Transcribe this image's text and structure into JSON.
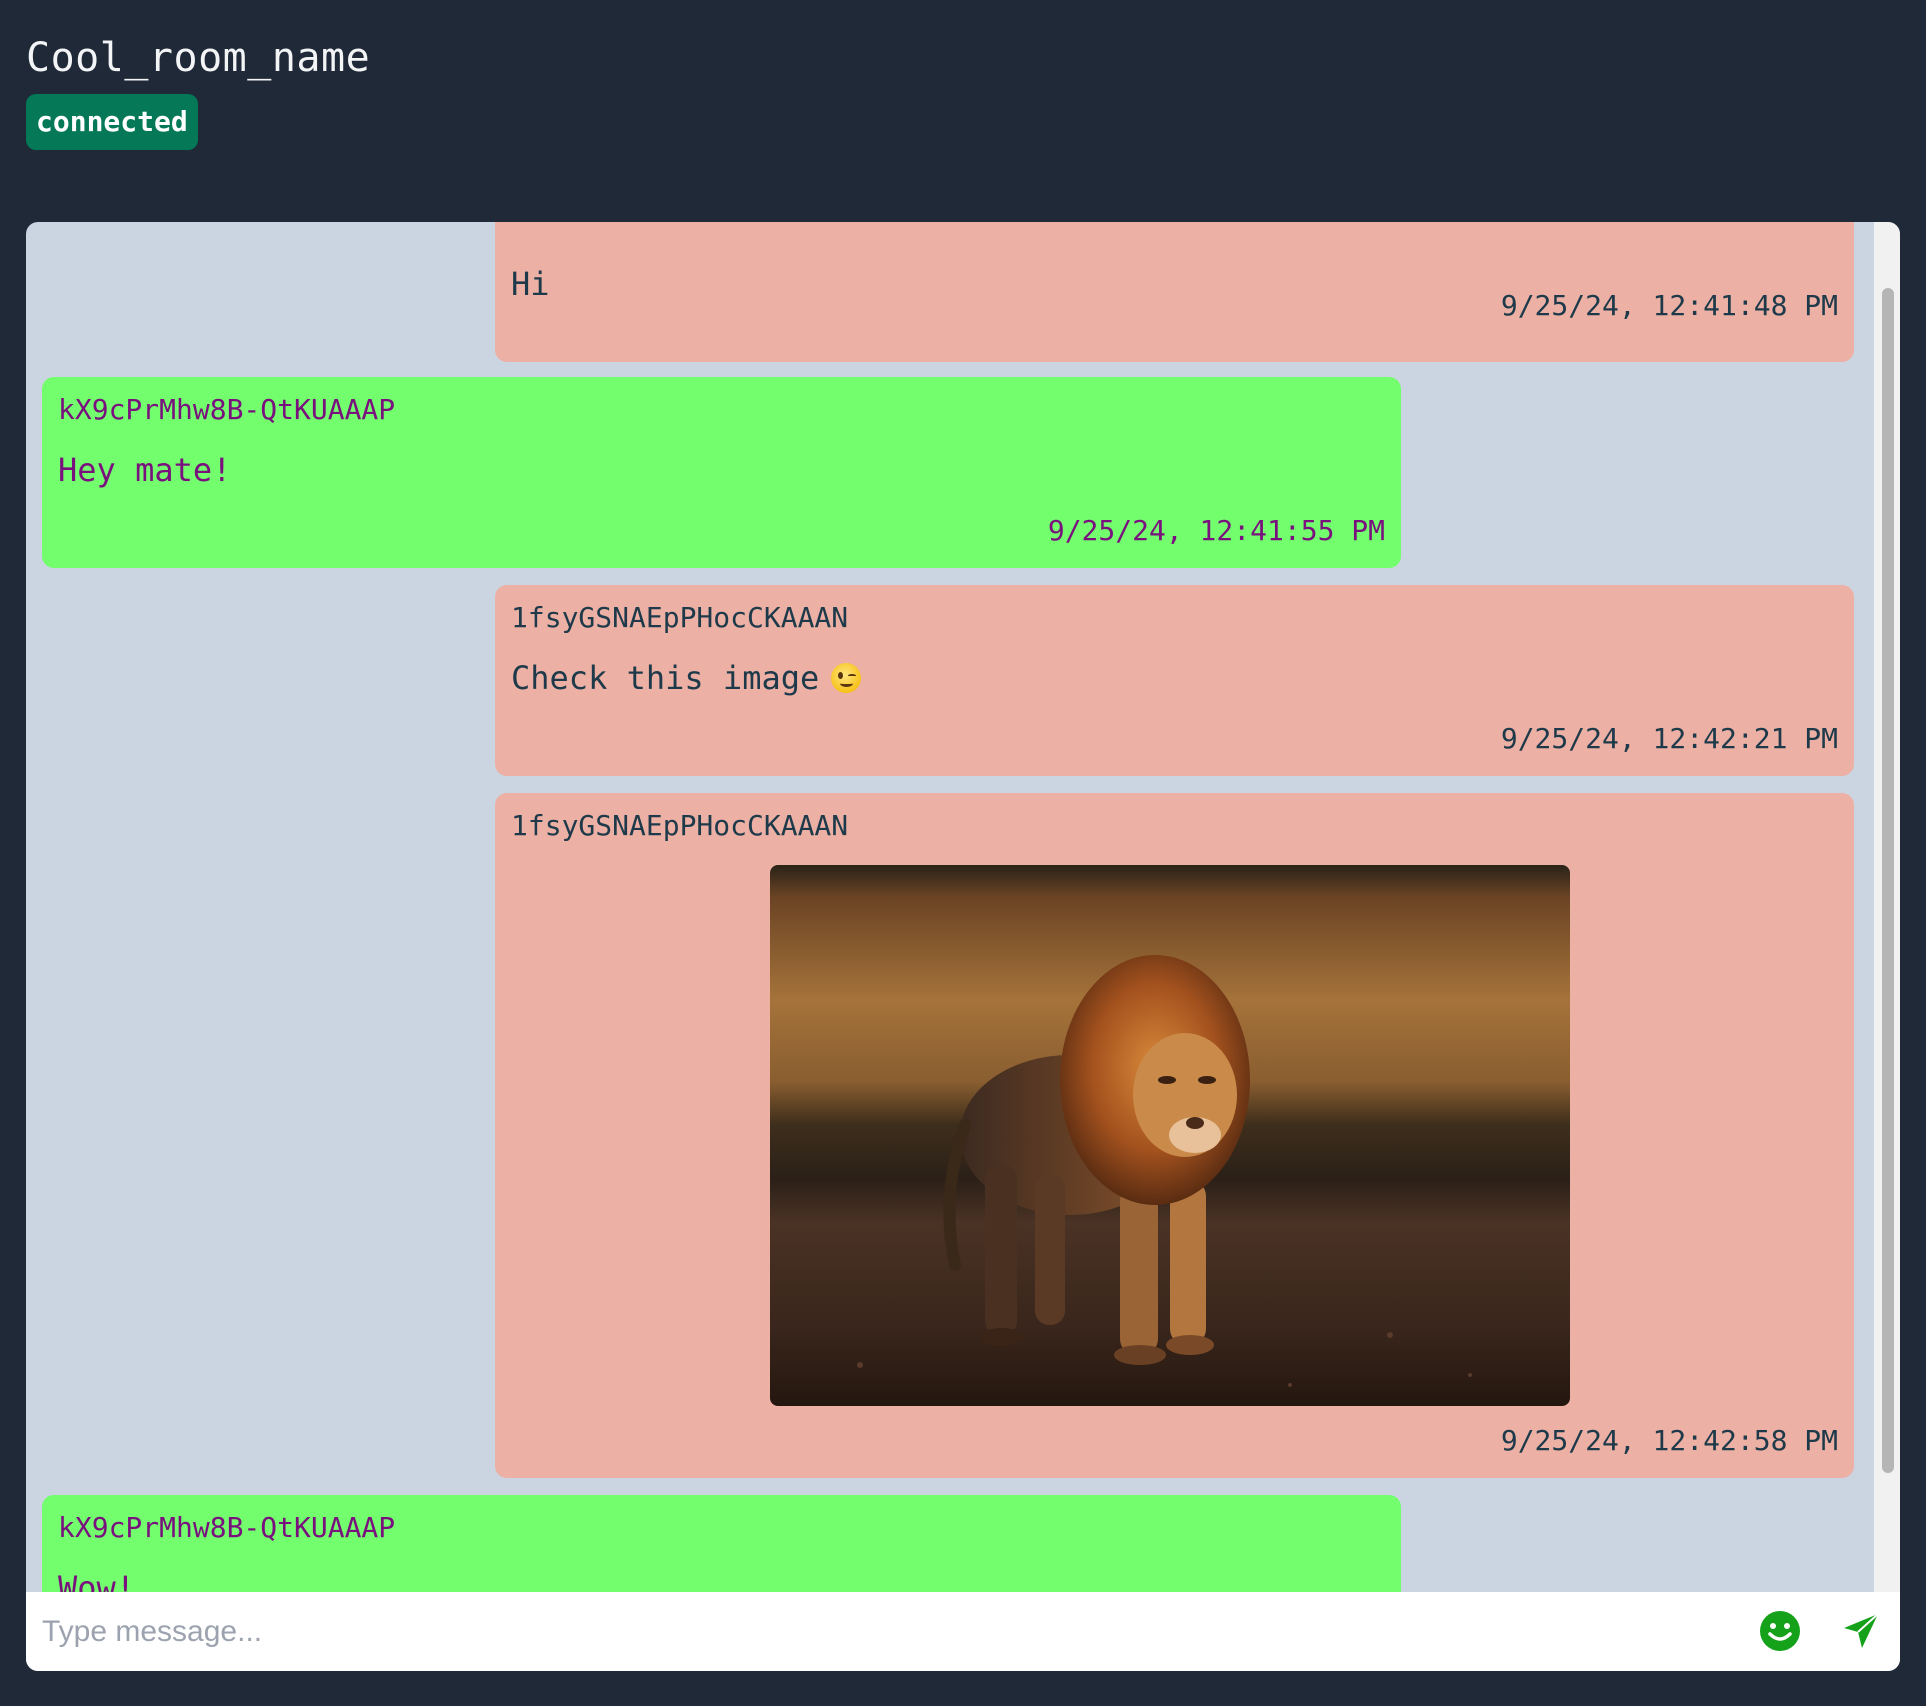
{
  "room": {
    "title": "Cool_room_name",
    "status": "connected"
  },
  "messages": [
    {
      "side": "mine",
      "sender": "",
      "text": "Hi",
      "time": "9/25/24, 12:41:48 PM"
    },
    {
      "side": "theirs",
      "sender": "kX9cPrMhw8B-QtKUAAAP",
      "text": "Hey mate!",
      "time": "9/25/24, 12:41:55 PM"
    },
    {
      "side": "mine",
      "sender": "1fsyGSNAEpPHocCKAAAN",
      "text": "Check this image",
      "emoji": "winking-face",
      "time": "9/25/24, 12:42:21 PM"
    },
    {
      "side": "mine",
      "sender": "1fsyGSNAEpPHocCKAAAN",
      "image": "lion-photo",
      "time": "9/25/24, 12:42:58 PM"
    },
    {
      "side": "theirs",
      "sender": "kX9cPrMhw8B-QtKUAAAP",
      "text": "Wow!",
      "time": ""
    }
  ],
  "composer": {
    "placeholder": "Type message...",
    "value": "",
    "emoji_icon": "smiley-icon",
    "send_icon": "send-arrow-icon"
  },
  "colors": {
    "background": "#1f2937",
    "status_badge": "#047857",
    "chat_panel": "#cbd5e1",
    "mine_bubble": "#ecb0a4",
    "theirs_bubble": "#72fe6d",
    "theirs_text": "#7a0f7e",
    "icon_accent": "#15a11a"
  }
}
